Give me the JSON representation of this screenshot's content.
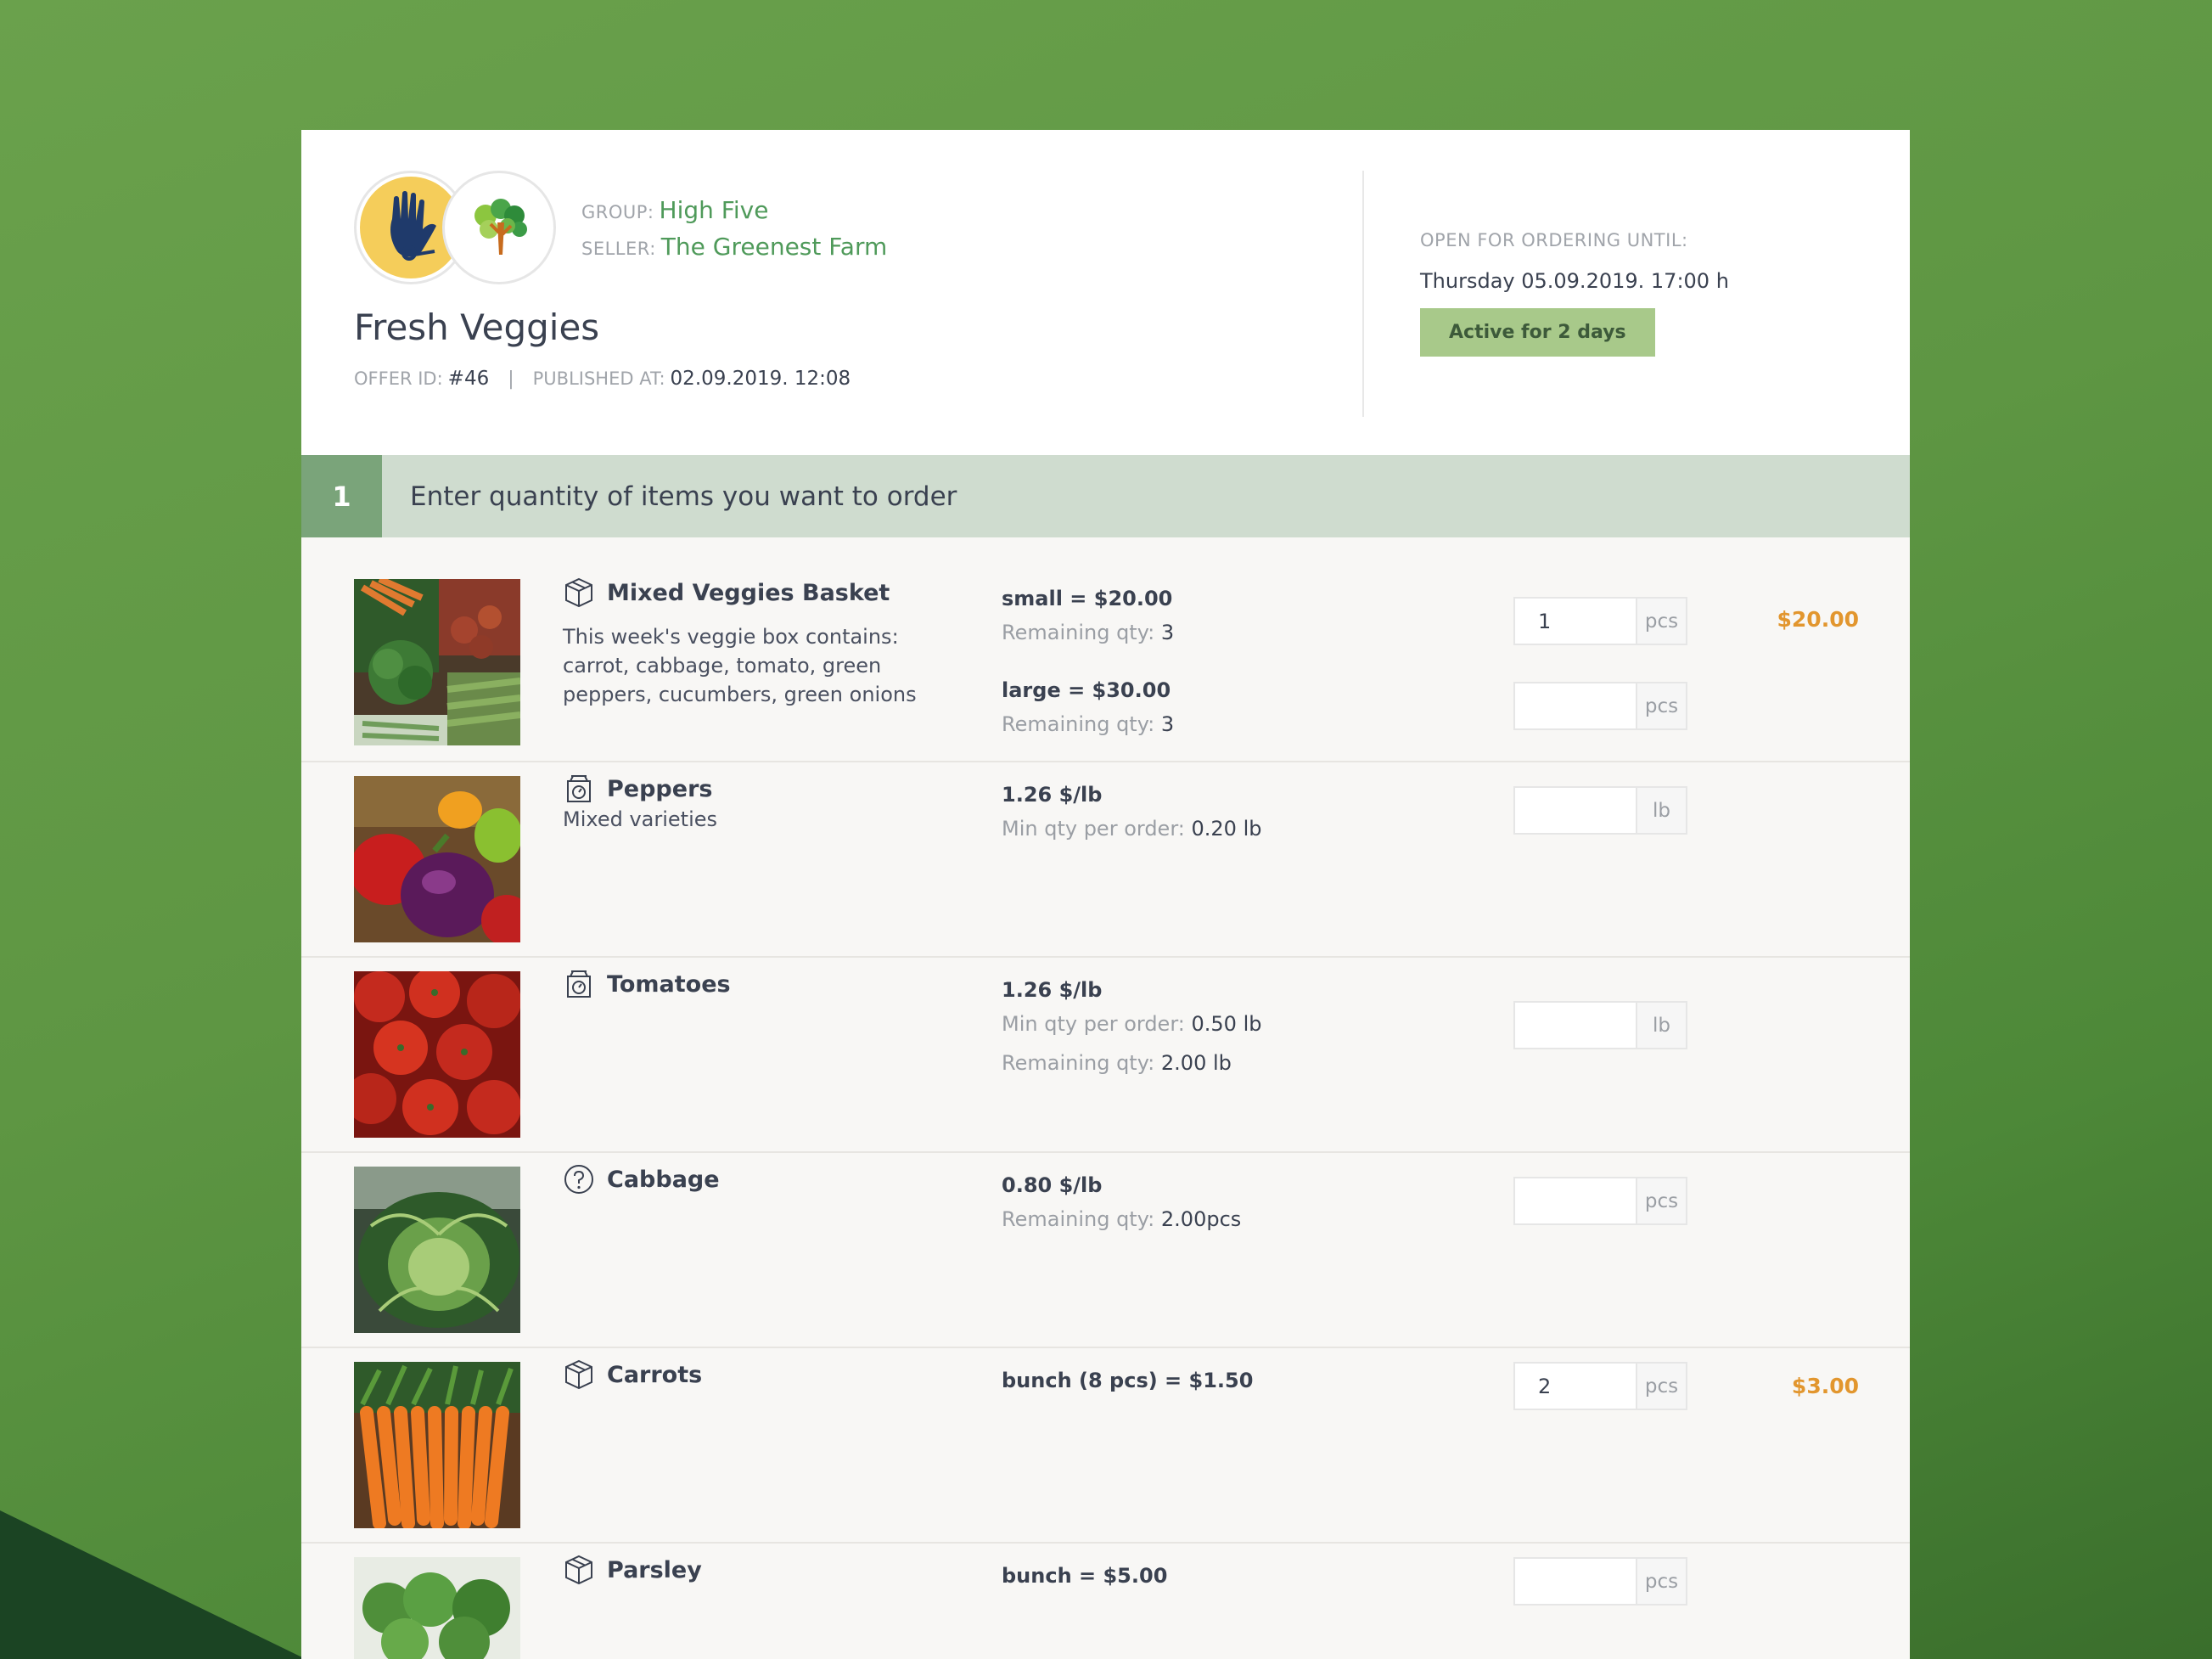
{
  "header": {
    "group_label": "GROUP:",
    "group_value": "High Five",
    "seller_label": "SELLER:",
    "seller_value": "The Greenest Farm",
    "title": "Fresh Veggies",
    "offer_label": "OFFER ID:",
    "offer_value": "#46",
    "separator": "|",
    "published_label": "PUBLISHED AT:",
    "published_value": "02.09.2019. 12:08",
    "order_until_label": "OPEN FOR ORDERING UNTIL:",
    "order_until_value": "Thursday 05.09.2019. 17:00 h",
    "active_badge": "Active for 2 days"
  },
  "step": {
    "number": "1",
    "text": "Enter quantity of items you want to order"
  },
  "products": [
    {
      "name": "Mixed Veggies Basket",
      "icon": "box-icon",
      "description": "This week's veggie box contains: carrot, cabbage, tomato, green peppers, cucumbers, green onions",
      "variants": [
        {
          "price": "small = $20.00",
          "qty_label": "Remaining qty:",
          "qty_value": "3",
          "input_value": "1",
          "unit": "pcs",
          "total": "$20.00"
        },
        {
          "price": "large = $30.00",
          "qty_label": "Remaining qty:",
          "qty_value": "3",
          "input_value": "",
          "unit": "pcs",
          "total": ""
        }
      ]
    },
    {
      "name": "Peppers",
      "icon": "scale-icon",
      "description": "Mixed varieties",
      "price": "1.26 $/lb",
      "line1_label": "Min qty per order:",
      "line1_value": "0.20 lb",
      "input_value": "",
      "unit": "lb",
      "total": ""
    },
    {
      "name": "Tomatoes",
      "icon": "scale-icon",
      "description": "",
      "price": "1.26 $/lb",
      "line1_label": "Min qty per order:",
      "line1_value": "0.50 lb",
      "line2_label": "Remaining qty:",
      "line2_value": "2.00 lb",
      "input_value": "",
      "unit": "lb",
      "total": ""
    },
    {
      "name": "Cabbage",
      "icon": "question-icon",
      "description": "",
      "price": "0.80 $/lb",
      "line1_label": "Remaining qty:",
      "line1_value": "2.00pcs",
      "input_value": "",
      "unit": "pcs",
      "total": ""
    },
    {
      "name": "Carrots",
      "icon": "box-icon",
      "description": "",
      "price": "bunch (8 pcs) = $1.50",
      "input_value": "2",
      "unit": "pcs",
      "total": "$3.00"
    },
    {
      "name": "Parsley",
      "icon": "box-icon",
      "description": "",
      "price": "bunch = $5.00",
      "input_value": "",
      "unit": "pcs",
      "total": ""
    }
  ],
  "colors": {
    "background": "#5e9643",
    "accent_green": "#4f9a5a",
    "badge": "#a8c98a",
    "step_bar": "#cfdccf",
    "step_number": "#7aa47a",
    "total": "#e2962e"
  }
}
